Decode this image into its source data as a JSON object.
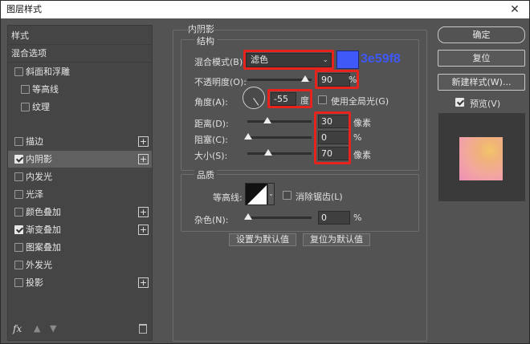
{
  "window": {
    "title": "图层样式",
    "close_icon": "close-icon"
  },
  "left_panel": {
    "items": [
      {
        "label": "样式",
        "checkbox": null,
        "plus": false,
        "selected": false
      },
      {
        "label": "混合选项",
        "checkbox": null,
        "plus": false,
        "selected": false
      },
      {
        "label": "斜面和浮雕",
        "checkbox": false,
        "plus": false,
        "selected": false
      },
      {
        "label": "等高线",
        "checkbox": false,
        "plus": false,
        "selected": false
      },
      {
        "label": "纹理",
        "checkbox": false,
        "plus": false,
        "selected": false
      },
      {
        "label": "描边",
        "checkbox": false,
        "plus": true,
        "selected": false
      },
      {
        "label": "内阴影",
        "checkbox": true,
        "plus": true,
        "selected": true
      },
      {
        "label": "内发光",
        "checkbox": false,
        "plus": false,
        "selected": false
      },
      {
        "label": "光泽",
        "checkbox": false,
        "plus": false,
        "selected": false
      },
      {
        "label": "颜色叠加",
        "checkbox": false,
        "plus": true,
        "selected": false
      },
      {
        "label": "渐变叠加",
        "checkbox": true,
        "plus": true,
        "selected": false
      },
      {
        "label": "图案叠加",
        "checkbox": false,
        "plus": false,
        "selected": false
      },
      {
        "label": "外发光",
        "checkbox": false,
        "plus": false,
        "selected": false
      },
      {
        "label": "投影",
        "checkbox": false,
        "plus": true,
        "selected": false
      }
    ],
    "footer": {
      "fx": "fx",
      "plus_sign": "+"
    }
  },
  "inner_shadow": {
    "section_title": "内阴影",
    "structure": {
      "title": "结构",
      "blend_mode_label": "混合模式(B):",
      "blend_mode_value": "滤色",
      "color_hex": "#3e59f8",
      "color_annotation": "3e59f8",
      "opacity_label": "不透明度(O):",
      "opacity_value": "90",
      "opacity_unit": "%",
      "opacity_level": 0.9,
      "angle_label": "角度(A):",
      "angle_value": "-55",
      "angle_unit": "度",
      "global_light_label": "使用全局光(G)",
      "global_light_checked": false,
      "distance_label": "距离(D):",
      "distance_value": "30",
      "distance_unit": "像素",
      "choke_label": "阻塞(C):",
      "choke_value": "0",
      "choke_unit": "%",
      "size_label": "大小(S):",
      "size_value": "70",
      "size_unit": "像素"
    },
    "quality": {
      "title": "品质",
      "contour_label": "等高线:",
      "anti_alias_label": "消除锯齿(L)",
      "anti_alias_checked": false,
      "noise_label": "杂色(N):",
      "noise_value": "0",
      "noise_unit": "%"
    },
    "buttons": {
      "set_default": "设置为默认值",
      "reset_default": "复位为默认值"
    }
  },
  "right": {
    "ok": "确定",
    "reset": "复位",
    "new_style": "新建样式(W)...",
    "preview_label": "预览(V)",
    "preview_checked": true
  },
  "colors": {
    "accent_red": "#e6241d",
    "swatch": "#3e59f8",
    "annotation": "#3e59f8"
  }
}
